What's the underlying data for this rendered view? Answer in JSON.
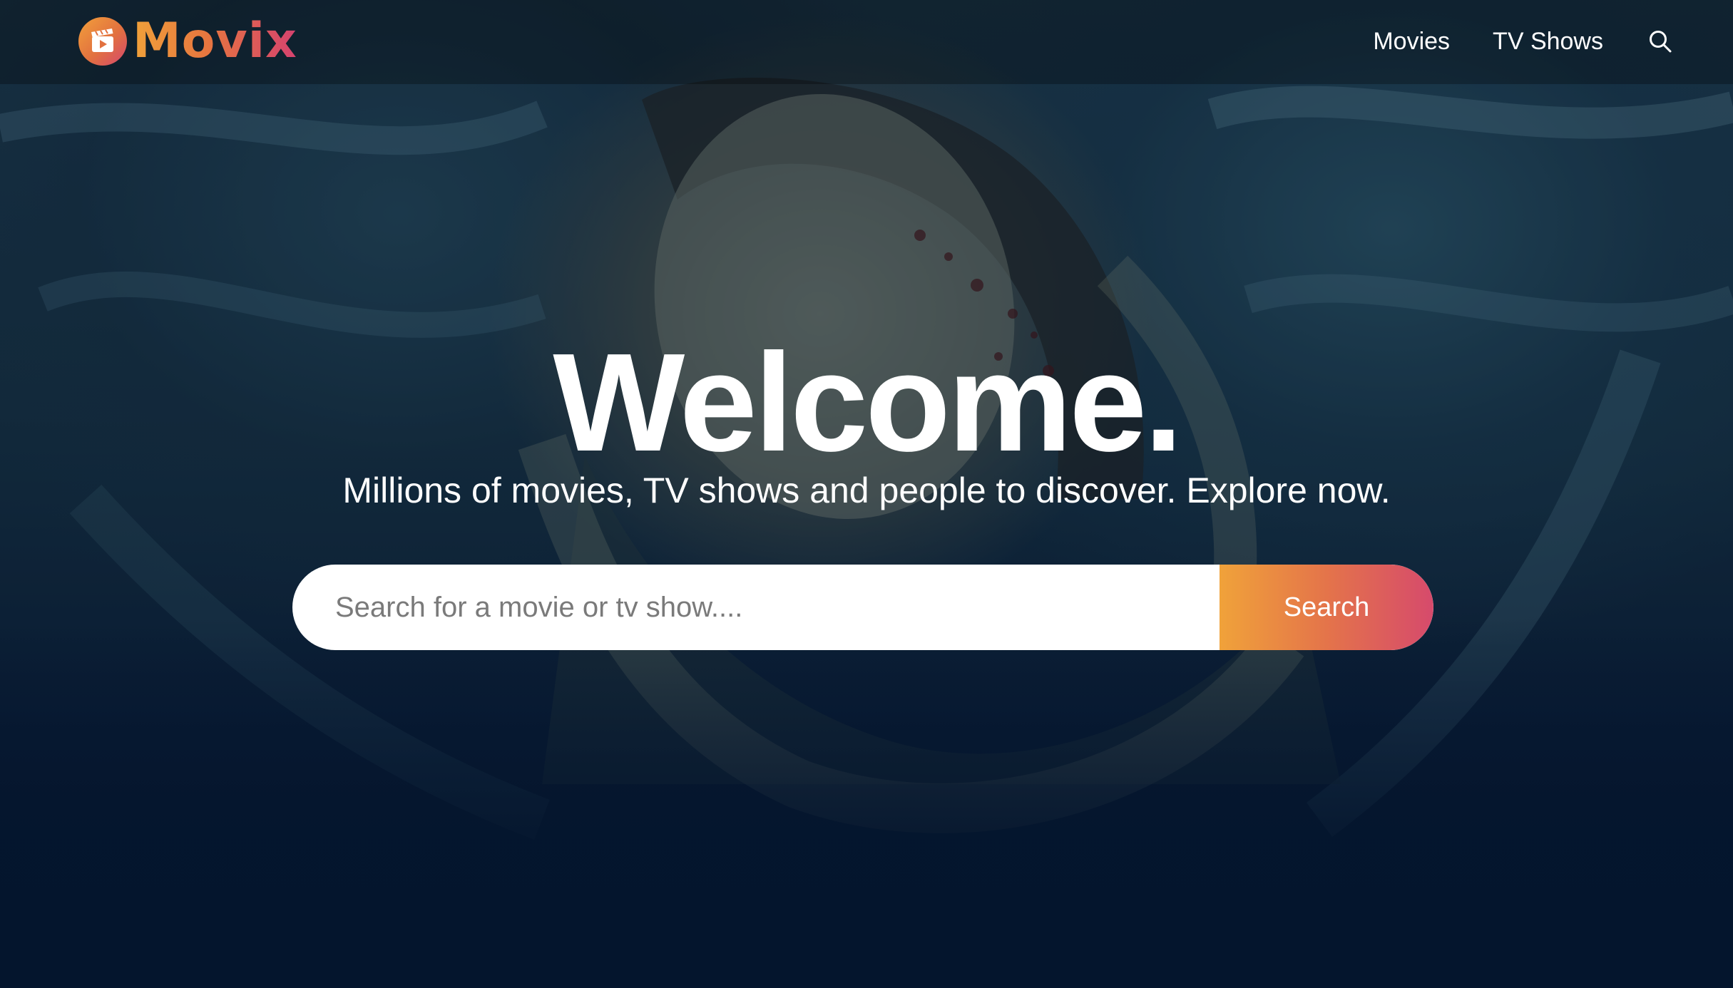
{
  "brand": {
    "name": "Movix",
    "logo_icon": "clapperboard-play-icon",
    "gradient_start": "#f2a03b",
    "gradient_end": "#d6476e"
  },
  "nav": {
    "items": [
      {
        "label": "Movies"
      },
      {
        "label": "TV Shows"
      }
    ],
    "search_icon": "search-icon"
  },
  "hero": {
    "title": "Welcome.",
    "subtitle": "Millions of movies, TV shows and people to discover. Explore now.",
    "search": {
      "placeholder": "Search for a movie or tv show....",
      "value": "",
      "button_label": "Search"
    }
  },
  "colors": {
    "page_background": "#04152d",
    "text": "#ffffff",
    "accent_orange": "#f0a23a",
    "accent_pink": "#d64a6c"
  }
}
